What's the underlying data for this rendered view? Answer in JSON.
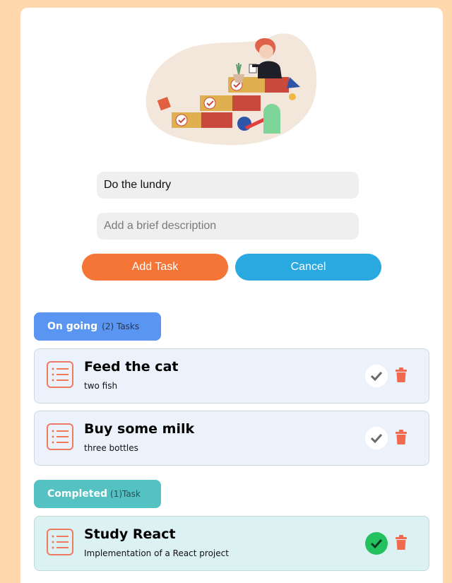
{
  "form": {
    "title_value": "Do the lundry",
    "title_placeholder": "",
    "description_value": "",
    "description_placeholder": "Add a brief description",
    "add_label": "Add Task",
    "cancel_label": "Cancel"
  },
  "sections": {
    "ongoing": {
      "title": "On going",
      "count": "(2) Tasks",
      "color": "#5b95f2",
      "tasks": [
        {
          "title": "Feed the cat",
          "description": "two fish",
          "icon": "list-icon",
          "completed": false
        },
        {
          "title": "Buy some milk",
          "description": "three bottles",
          "icon": "list-icon",
          "completed": false
        }
      ]
    },
    "completed": {
      "title": "Completed",
      "count": "(1)Task",
      "color": "#54c1c2",
      "tasks": [
        {
          "title": "Study React",
          "description": "Implementation of a React project",
          "icon": "list-icon",
          "completed": true
        }
      ]
    }
  },
  "colors": {
    "page_background": "#ffd8ae",
    "add_button": "#f47536",
    "cancel_button": "#2aa8e0",
    "delete_icon": "#f06a4d",
    "complete_check": "#24c15f"
  }
}
